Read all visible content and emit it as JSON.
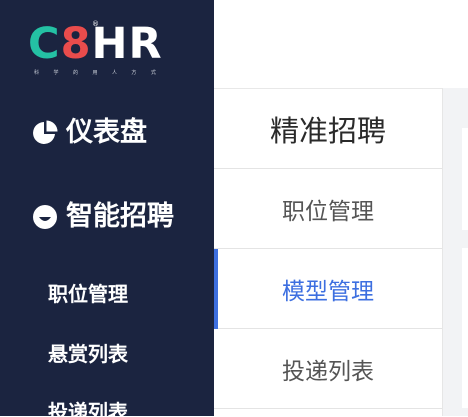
{
  "brand": {
    "logo_c": "C",
    "logo_8": "8",
    "logo_hr": "HR",
    "logo_reg": "®",
    "slogan": [
      "科",
      "学",
      "的",
      "用",
      "人",
      "方",
      "式"
    ],
    "colors": {
      "c": "#24c1a4",
      "eight": "#e94c4c",
      "hr": "#ffffff"
    }
  },
  "sidebar": {
    "background": "#1b2440",
    "groups": [
      {
        "label": "仪表盘",
        "icon": "pie-chart-icon"
      },
      {
        "label": "智能招聘",
        "icon": "smile-icon"
      }
    ],
    "sub_items": [
      {
        "label": "职位管理"
      },
      {
        "label": "悬赏列表"
      },
      {
        "label": "投递列表"
      }
    ]
  },
  "subnav": {
    "title": "精准招聘",
    "items": [
      {
        "label": "职位管理",
        "active": false
      },
      {
        "label": "模型管理",
        "active": true
      },
      {
        "label": "投递列表",
        "active": false
      }
    ],
    "accent": "#3d6fe0"
  }
}
